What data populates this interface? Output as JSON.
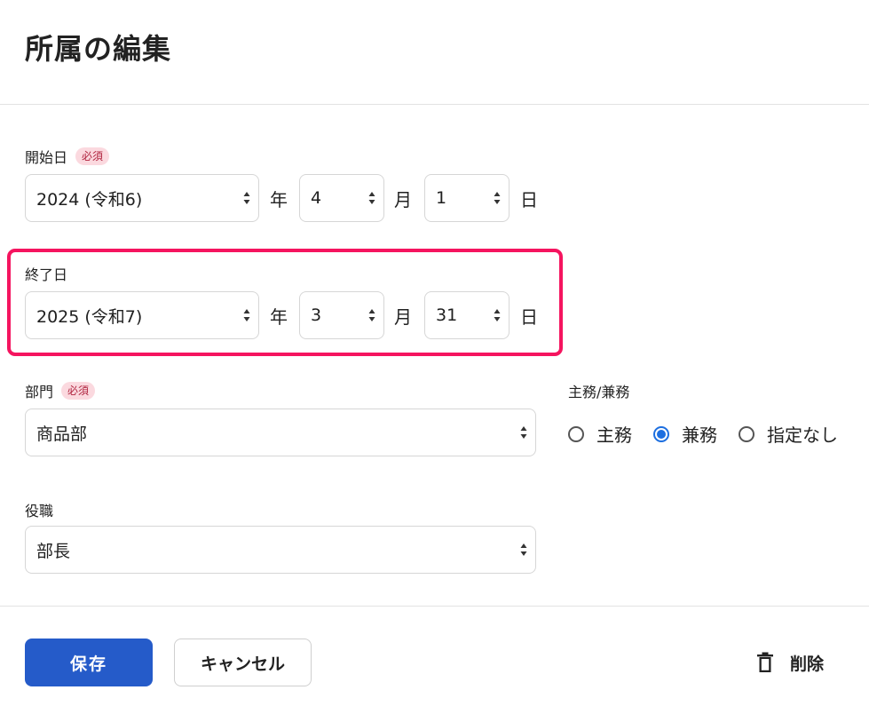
{
  "dialog": {
    "title": "所属の編集"
  },
  "required_badge": "必須",
  "start_date": {
    "label": "開始日",
    "year": "2024 (令和6)",
    "year_unit": "年",
    "month": "4",
    "month_unit": "月",
    "day": "1",
    "day_unit": "日"
  },
  "end_date": {
    "label": "終了日",
    "year": "2025 (令和7)",
    "year_unit": "年",
    "month": "3",
    "month_unit": "月",
    "day": "31",
    "day_unit": "日"
  },
  "department": {
    "label": "部門",
    "value": "商品部"
  },
  "assignment_type": {
    "label": "主務/兼務",
    "options": [
      "主務",
      "兼務",
      "指定なし"
    ],
    "selected": "兼務"
  },
  "position": {
    "label": "役職",
    "value": "部長"
  },
  "actions": {
    "save": "保存",
    "cancel": "キャンセル",
    "delete": "削除"
  },
  "colors": {
    "primary": "#255bc9",
    "highlight": "#f5145f",
    "radio_checked": "#1d6fe0",
    "badge_bg": "#fbd9df",
    "badge_text": "#b0243f"
  },
  "icons": [
    "sort-arrows-icon",
    "trash-icon"
  ]
}
